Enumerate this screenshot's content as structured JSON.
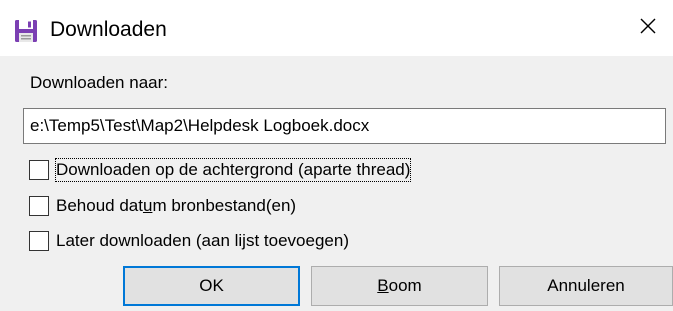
{
  "window": {
    "title": "Downloaden",
    "close_glyph": "✕",
    "app_icon": "floppy-disk-icon",
    "accent_color": "#0078d7"
  },
  "form": {
    "target_label": "Downloaden naar:",
    "target_path": "e:\\Temp5\\Test\\Map2\\Helpdesk Logboek.docx"
  },
  "options": {
    "background_thread": {
      "label": "Downloaden op de achtergrond (aparte thread)",
      "checked": false
    },
    "keep_date": {
      "label_pre": "Behoud dat",
      "label_accel": "u",
      "label_post": "m bronbestand(en)",
      "checked": false
    },
    "later": {
      "label": "Later downloaden (aan lijst toevoegen)",
      "checked": false
    }
  },
  "buttons": {
    "ok": "OK",
    "boom_accel": "B",
    "boom_rest": "oom",
    "cancel": "Annuleren"
  }
}
